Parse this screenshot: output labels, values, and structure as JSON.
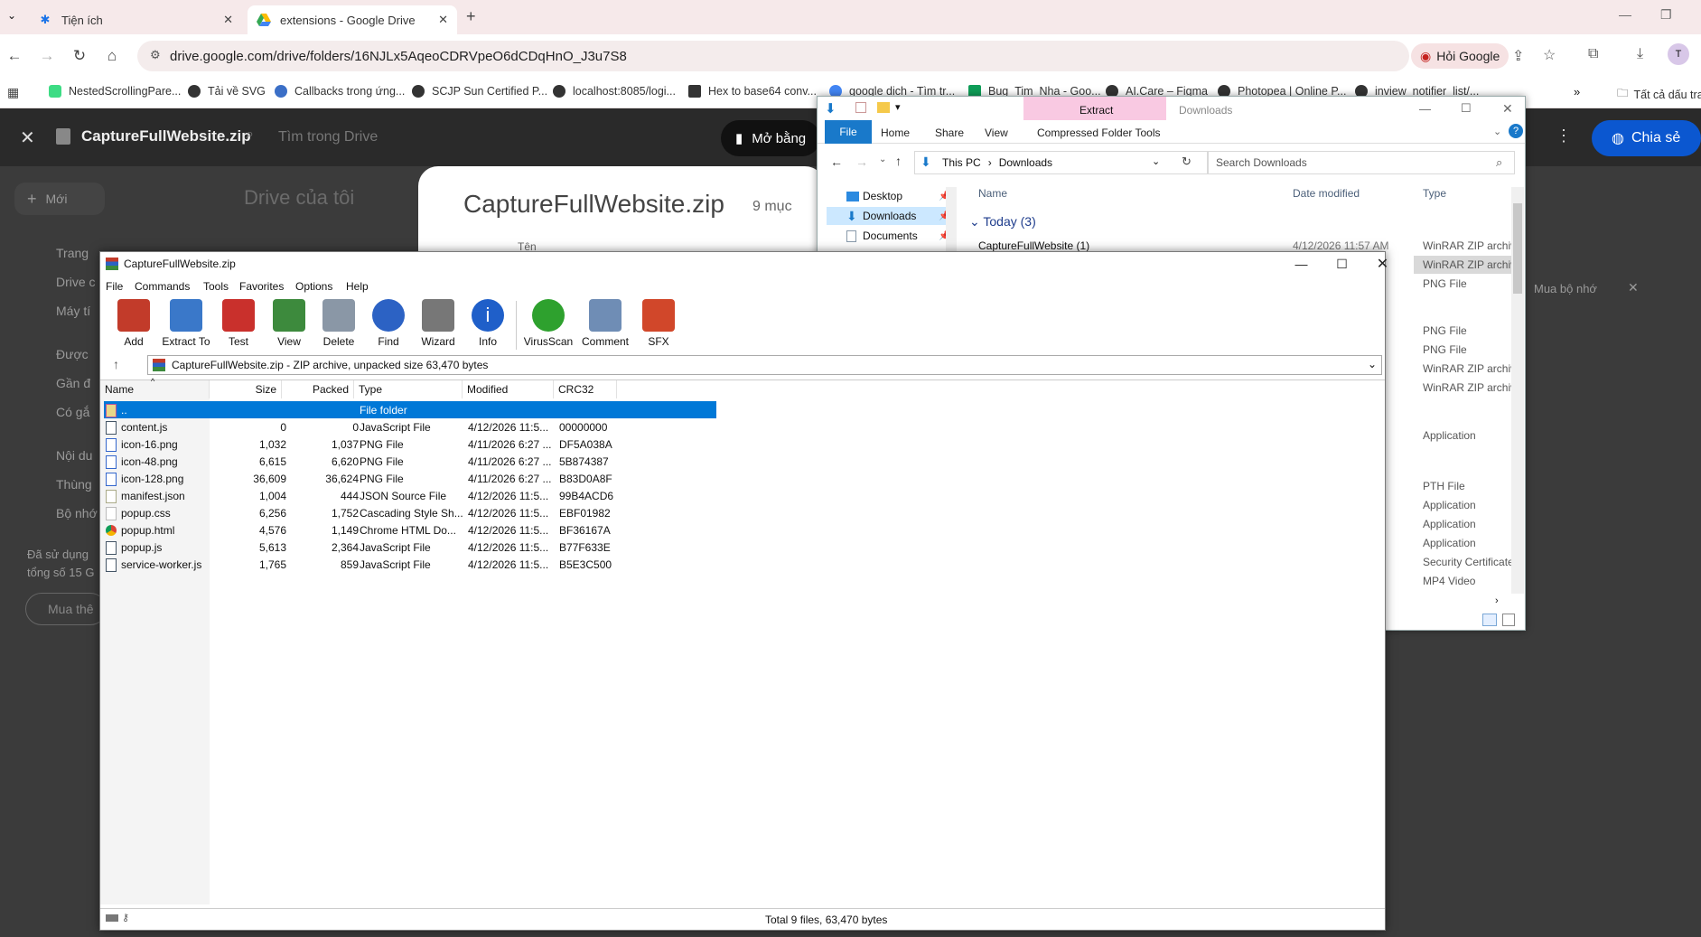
{
  "browser": {
    "tabs": [
      {
        "title": "Tiện ích",
        "icon": "puzzle-icon"
      },
      {
        "title": "extensions - Google Drive",
        "icon": "drive-icon"
      }
    ],
    "url": "drive.google.com/drive/folders/16NJLx5AqeoCDRVpeO6dCDqHnO_J3u7S8",
    "ask_google": "Hỏi Google",
    "bookmarks": [
      "NestedScrollingPare...",
      "Tải về SVG",
      "Callbacks trong ứng...",
      "SCJP Sun Certified P...",
      "localhost:8085/logi...",
      "Hex to base64 conv...",
      "google dịch - Tìm tr...",
      "Bug_Tim_Nha - Goo...",
      "AI.Care – Figma",
      "Photopea | Online P...",
      "inview_notifier_list/..."
    ],
    "all_bookmarks": "Tất cả dấu tra"
  },
  "drive": {
    "file_title": "CaptureFullWebsite.zip",
    "search_placeholder": "Tìm trong Drive",
    "open_with": "Mở bằng",
    "new_button": "Mới",
    "my_drive": "Drive của tôi",
    "preview_title": "CaptureFullWebsite.zip",
    "preview_count": "9 mục",
    "preview_col": "Tên",
    "share": "Chia sẻ",
    "buy_storage": "Mua bộ nhớ",
    "side_items": [
      "Trang",
      "Drive c",
      "Máy tí",
      "Được",
      "Gần đ",
      "Có gắ",
      "Nội du",
      "Thùng",
      "Bộ nhớ"
    ],
    "storage_text_1": "Đã sử dụng",
    "storage_text_2": "tổng số 15 G",
    "buy_button": "Mua thê"
  },
  "explorer": {
    "title": "Downloads",
    "extract_tab": "Extract",
    "ribbon_tabs": [
      "File",
      "Home",
      "Share",
      "View",
      "Compressed Folder Tools"
    ],
    "path": [
      "This PC",
      "Downloads"
    ],
    "search_placeholder": "Search Downloads",
    "nav": [
      "Desktop",
      "Downloads",
      "Documents"
    ],
    "columns": [
      "Name",
      "Date modified",
      "Type"
    ],
    "group": "Today (3)",
    "first_file": "CaptureFullWebsite (1)",
    "first_date": "4/12/2026 11:57 AM",
    "types": [
      "WinRAR ZIP archiv",
      "WinRAR ZIP archiv",
      "PNG File",
      "PNG File",
      "PNG File",
      "WinRAR ZIP archiv",
      "WinRAR ZIP archiv",
      "Application",
      "PTH File",
      "Application",
      "Application",
      "Application",
      "Security Certificate",
      "MP4 Video"
    ]
  },
  "winrar": {
    "title": "CaptureFullWebsite.zip",
    "menu": [
      "File",
      "Commands",
      "Tools",
      "Favorites",
      "Options",
      "Help"
    ],
    "tools": [
      {
        "label": "Add",
        "icon": "add-archive-icon",
        "color": "#c23b2a"
      },
      {
        "label": "Extract To",
        "icon": "extract-folder-icon",
        "color": "#3a78c9"
      },
      {
        "label": "Test",
        "icon": "test-clipboard-icon",
        "color": "#c9302c"
      },
      {
        "label": "View",
        "icon": "view-book-icon",
        "color": "#3d8a3d"
      },
      {
        "label": "Delete",
        "icon": "trash-icon",
        "color": "#8a97a6"
      },
      {
        "label": "Find",
        "icon": "magnifier-icon",
        "color": "#2c62c4"
      },
      {
        "label": "Wizard",
        "icon": "wizard-wand-icon",
        "color": "#777777"
      },
      {
        "label": "Info",
        "icon": "info-icon",
        "color": "#1f5fc9"
      },
      {
        "label": "VirusScan",
        "icon": "virus-scan-icon",
        "color": "#2ea12e"
      },
      {
        "label": "Comment",
        "icon": "comment-icon",
        "color": "#6f8db5"
      },
      {
        "label": "SFX",
        "icon": "sfx-box-icon",
        "color": "#d1472a"
      }
    ],
    "path": "CaptureFullWebsite.zip - ZIP archive, unpacked size 63,470 bytes",
    "columns": [
      "Name",
      "Size",
      "Packed",
      "Type",
      "Modified",
      "CRC32"
    ],
    "rows": [
      {
        "name": "..",
        "size": "",
        "packed": "",
        "type": "File folder",
        "modified": "",
        "crc": ""
      },
      {
        "name": "content.js",
        "size": "0",
        "packed": "0",
        "type": "JavaScript File",
        "modified": "4/12/2026 11:5...",
        "crc": "00000000"
      },
      {
        "name": "icon-16.png",
        "size": "1,032",
        "packed": "1,037",
        "type": "PNG File",
        "modified": "4/11/2026 6:27 ...",
        "crc": "DF5A038A"
      },
      {
        "name": "icon-48.png",
        "size": "6,615",
        "packed": "6,620",
        "type": "PNG File",
        "modified": "4/11/2026 6:27 ...",
        "crc": "5B874387"
      },
      {
        "name": "icon-128.png",
        "size": "36,609",
        "packed": "36,624",
        "type": "PNG File",
        "modified": "4/11/2026 6:27 ...",
        "crc": "B83D0A8F"
      },
      {
        "name": "manifest.json",
        "size": "1,004",
        "packed": "444",
        "type": "JSON Source File",
        "modified": "4/12/2026 11:5...",
        "crc": "99B4ACD6"
      },
      {
        "name": "popup.css",
        "size": "6,256",
        "packed": "1,752",
        "type": "Cascading Style Sh...",
        "modified": "4/12/2026 11:5...",
        "crc": "EBF01982"
      },
      {
        "name": "popup.html",
        "size": "4,576",
        "packed": "1,149",
        "type": "Chrome HTML Do...",
        "modified": "4/12/2026 11:5...",
        "crc": "BF36167A"
      },
      {
        "name": "popup.js",
        "size": "5,613",
        "packed": "2,364",
        "type": "JavaScript File",
        "modified": "4/12/2026 11:5...",
        "crc": "B77F633E"
      },
      {
        "name": "service-worker.js",
        "size": "1,765",
        "packed": "859",
        "type": "JavaScript File",
        "modified": "4/12/2026 11:5...",
        "crc": "B5E3C500"
      }
    ],
    "status": "Total 9 files, 63,470 bytes"
  }
}
